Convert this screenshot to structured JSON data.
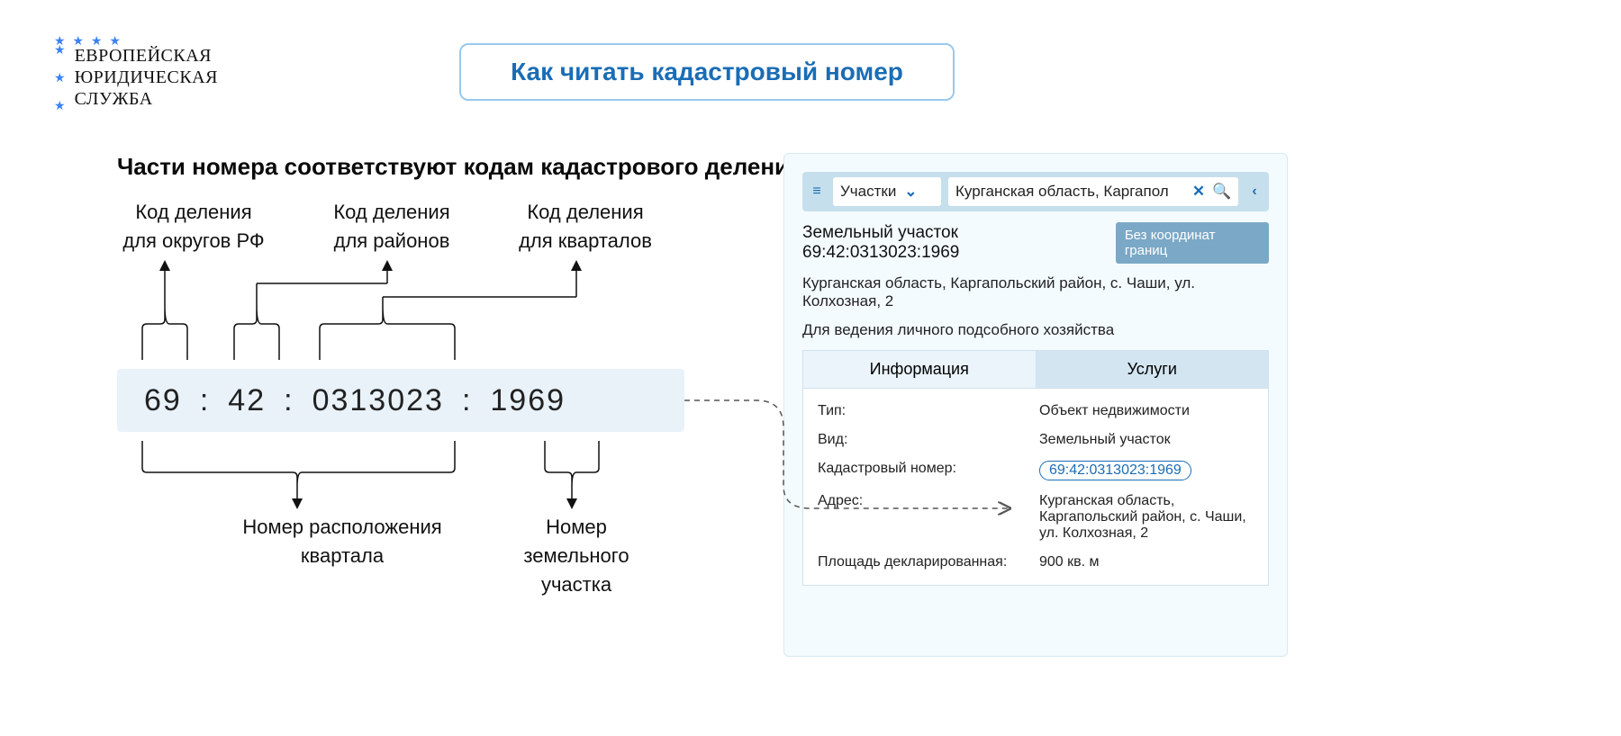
{
  "logo": {
    "line1": "ЕВРОПЕЙСКАЯ",
    "line2": "ЮРИДИЧЕСКАЯ",
    "line3": "СЛУЖБА"
  },
  "title": "Как читать кадастровый номер",
  "heading": "Части номера соответствуют кодам кадастрового деления",
  "labels": {
    "top1a": "Код деления",
    "top1b": "для округов РФ",
    "top2a": "Код деления",
    "top2b": "для районов",
    "top3a": "Код деления",
    "top3b": "для кварталов",
    "bot1a": "Номер расположения",
    "bot1b": "квартала",
    "bot2a": "Номер",
    "bot2b": "земельного",
    "bot2c": "участка"
  },
  "cadastral": {
    "p1": "69",
    "p2": "42",
    "p3": "0313023",
    "p4": "1969",
    "sep": ":"
  },
  "panel": {
    "filter_label": "Участки",
    "search_value": "Курганская область, Каргапол",
    "result_title": "Земельный участок 69:42:0313023:1969",
    "badge": "Без координат границ",
    "address": "Курганская область, Каргапольский район, с. Чаши, ул. Колхозная, 2",
    "purpose": "Для ведения личного подсобного хозяйства",
    "tab_info": "Информация",
    "tab_serv": "Услуги",
    "kv": {
      "type_k": "Тип:",
      "type_v": "Объект недвижимости",
      "kind_k": "Вид:",
      "kind_v": "Земельный участок",
      "cad_k": "Кадастровый номер:",
      "cad_v": "69:42:0313023:1969",
      "addr_k": "Адрес:",
      "addr_v": "Курганская область, Каргапольский район, с. Чаши, ул. Колхозная, 2",
      "area_k": "Площадь декларированная:",
      "area_v": "900 кв. м"
    }
  }
}
